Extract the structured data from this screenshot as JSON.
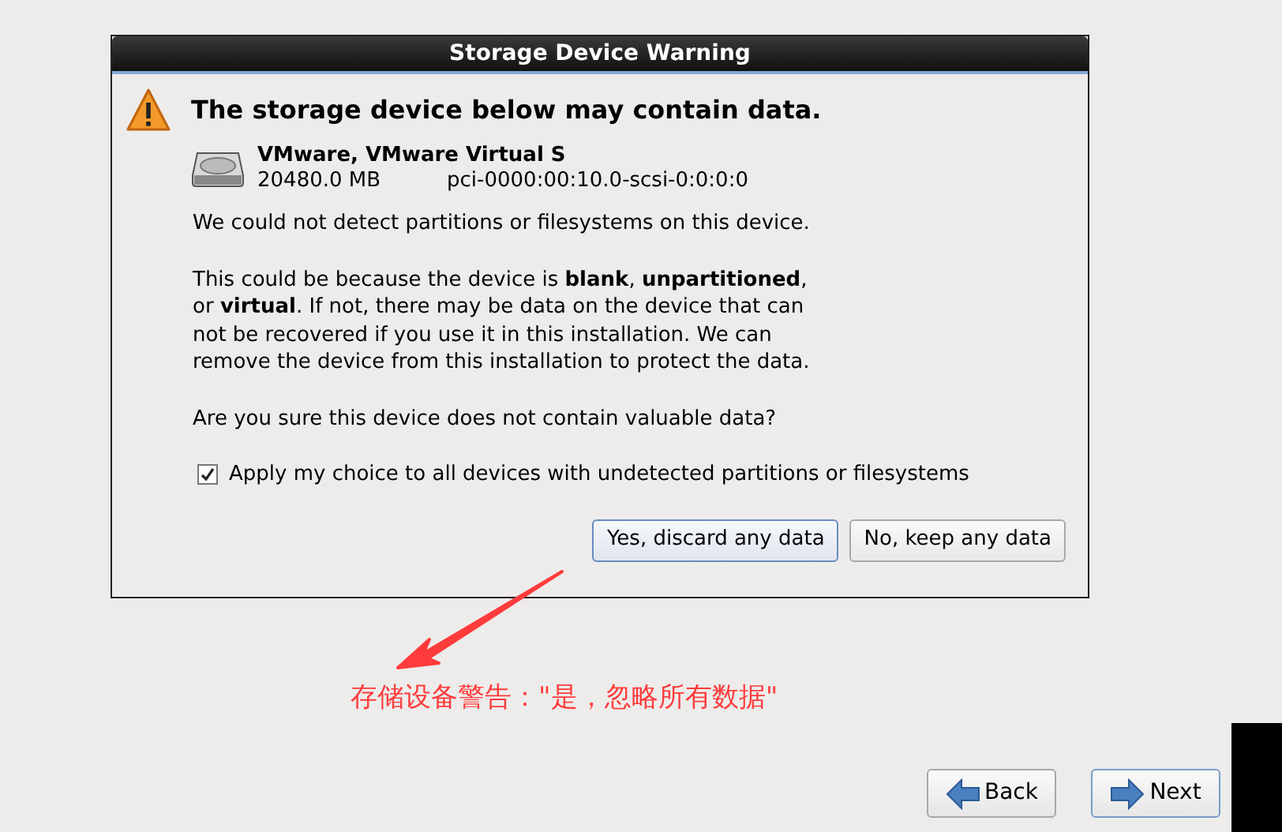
{
  "dialog": {
    "title": "Storage Device Warning",
    "heading": "The storage device below may contain data.",
    "device": {
      "name": "VMware, VMware Virtual S",
      "size": "20480.0 MB",
      "path": "pci-0000:00:10.0-scsi-0:0:0:0"
    },
    "paragraphs": [
      "We could not detect partitions or filesystems on this device.",
      "This could be because the device is **blank**, **unpartitioned**, or **virtual**. If not, there may be data on the device that can not be recovered if you use it in this installation. We can remove the device from this installation to protect the data.",
      "Are you sure this device does not contain valuable data?"
    ],
    "apply_all": {
      "label": "Apply my choice to all devices with undetected partitions or filesystems",
      "checked": true
    },
    "buttons": [
      {
        "label": "Yes, discard any data",
        "selected": true
      },
      {
        "label": "No, keep any data",
        "selected": false
      }
    ]
  },
  "annotation": {
    "text": "存储设备警告：\"是，忽略所有数据\""
  },
  "nav_buttons": [
    {
      "label": "Back",
      "kind": "back"
    },
    {
      "label": "Next",
      "kind": "next"
    }
  ]
}
